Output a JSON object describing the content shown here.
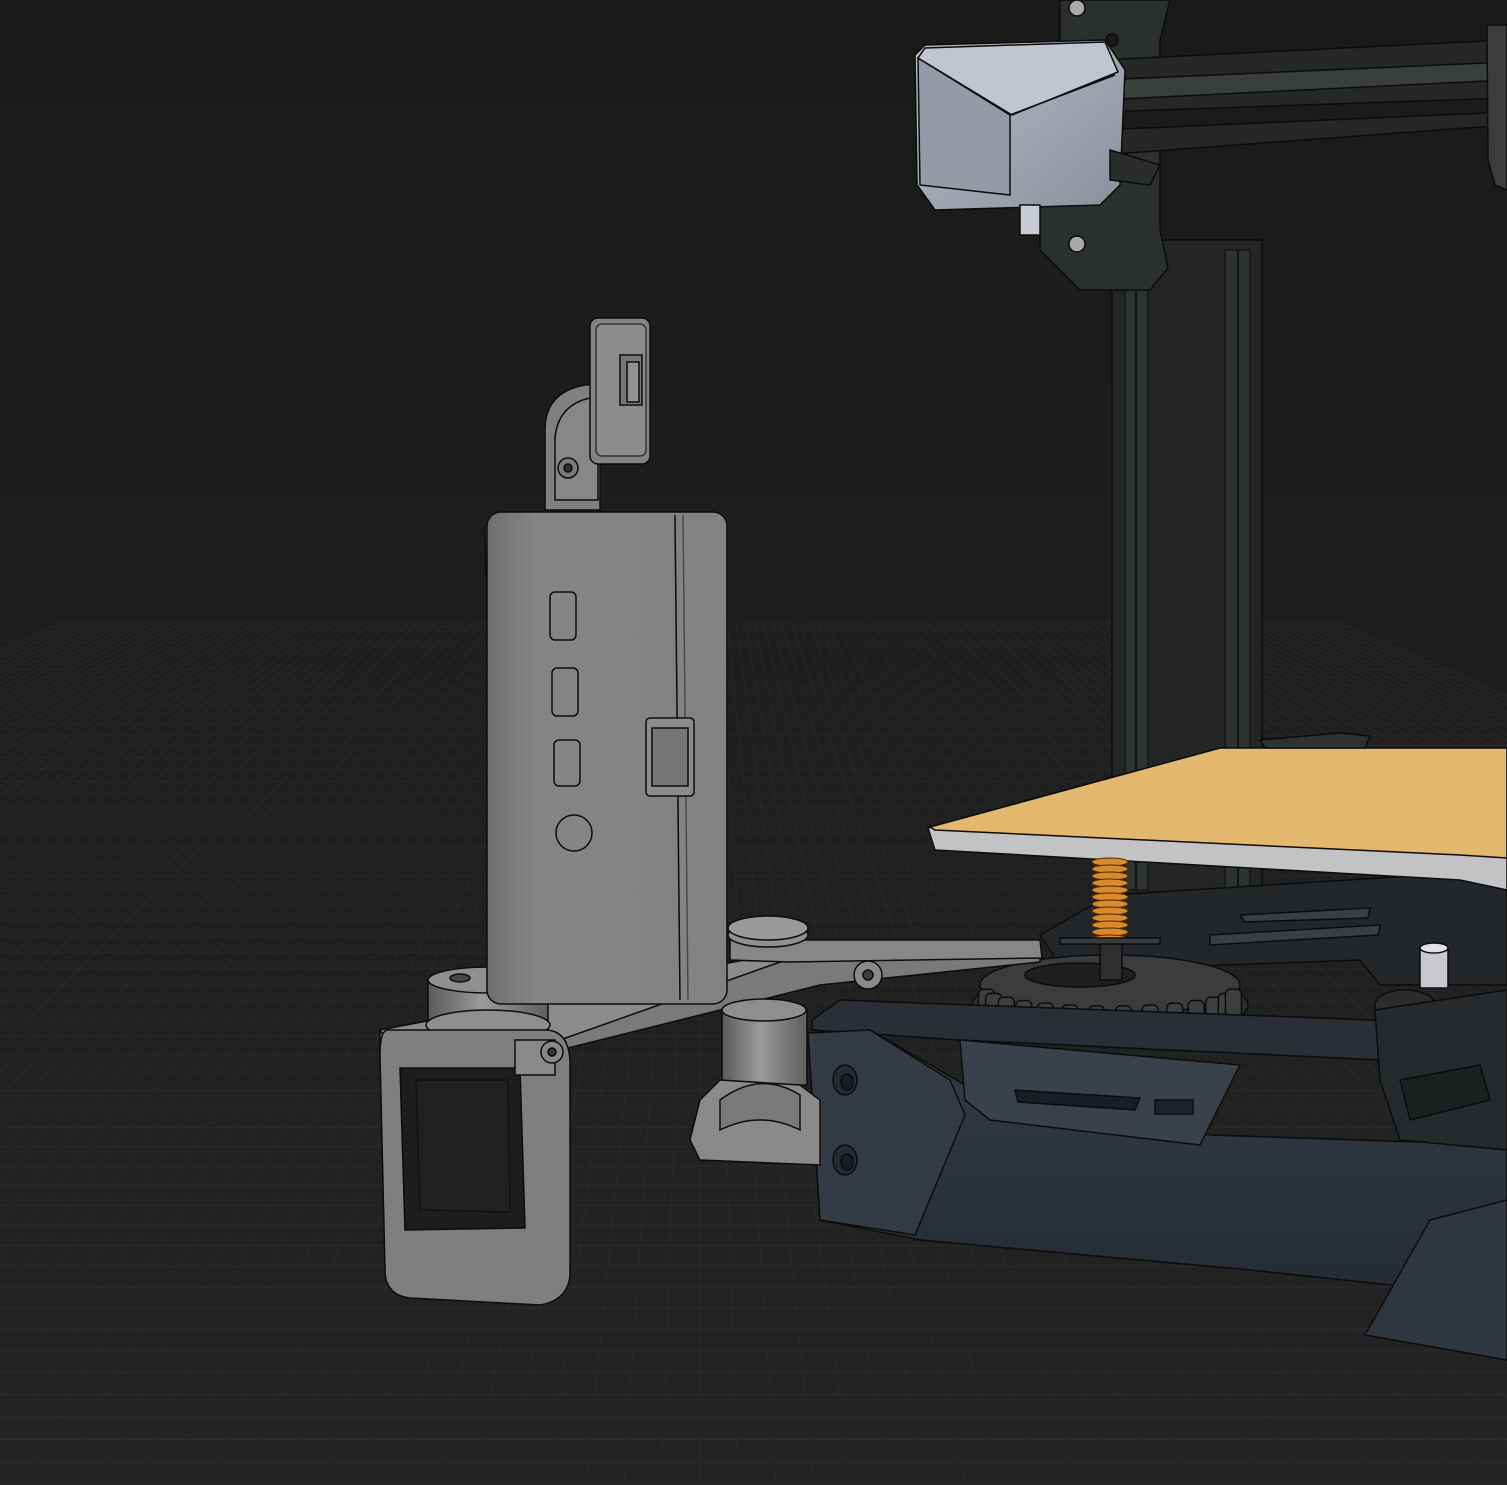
{
  "viewport": {
    "background_top": "#1a1a1a",
    "background_bottom": "#232323",
    "grid_color": "#3a3a3a",
    "grid_visible": true
  },
  "scene": {
    "part_gray": "#7d7d7d",
    "part_gray_light": "#8a8a8a",
    "part_gray_dark": "#5e5e5e",
    "frame_dark": "#2b2e2c",
    "frame_black": "#1c1e1d",
    "base_blue_gray": "#2f3640",
    "motor_light": "#a5a8b5",
    "bed_surface": "#e3b36b",
    "spring_orange": "#d98a2b",
    "edge_line": "#0d0d0d"
  }
}
